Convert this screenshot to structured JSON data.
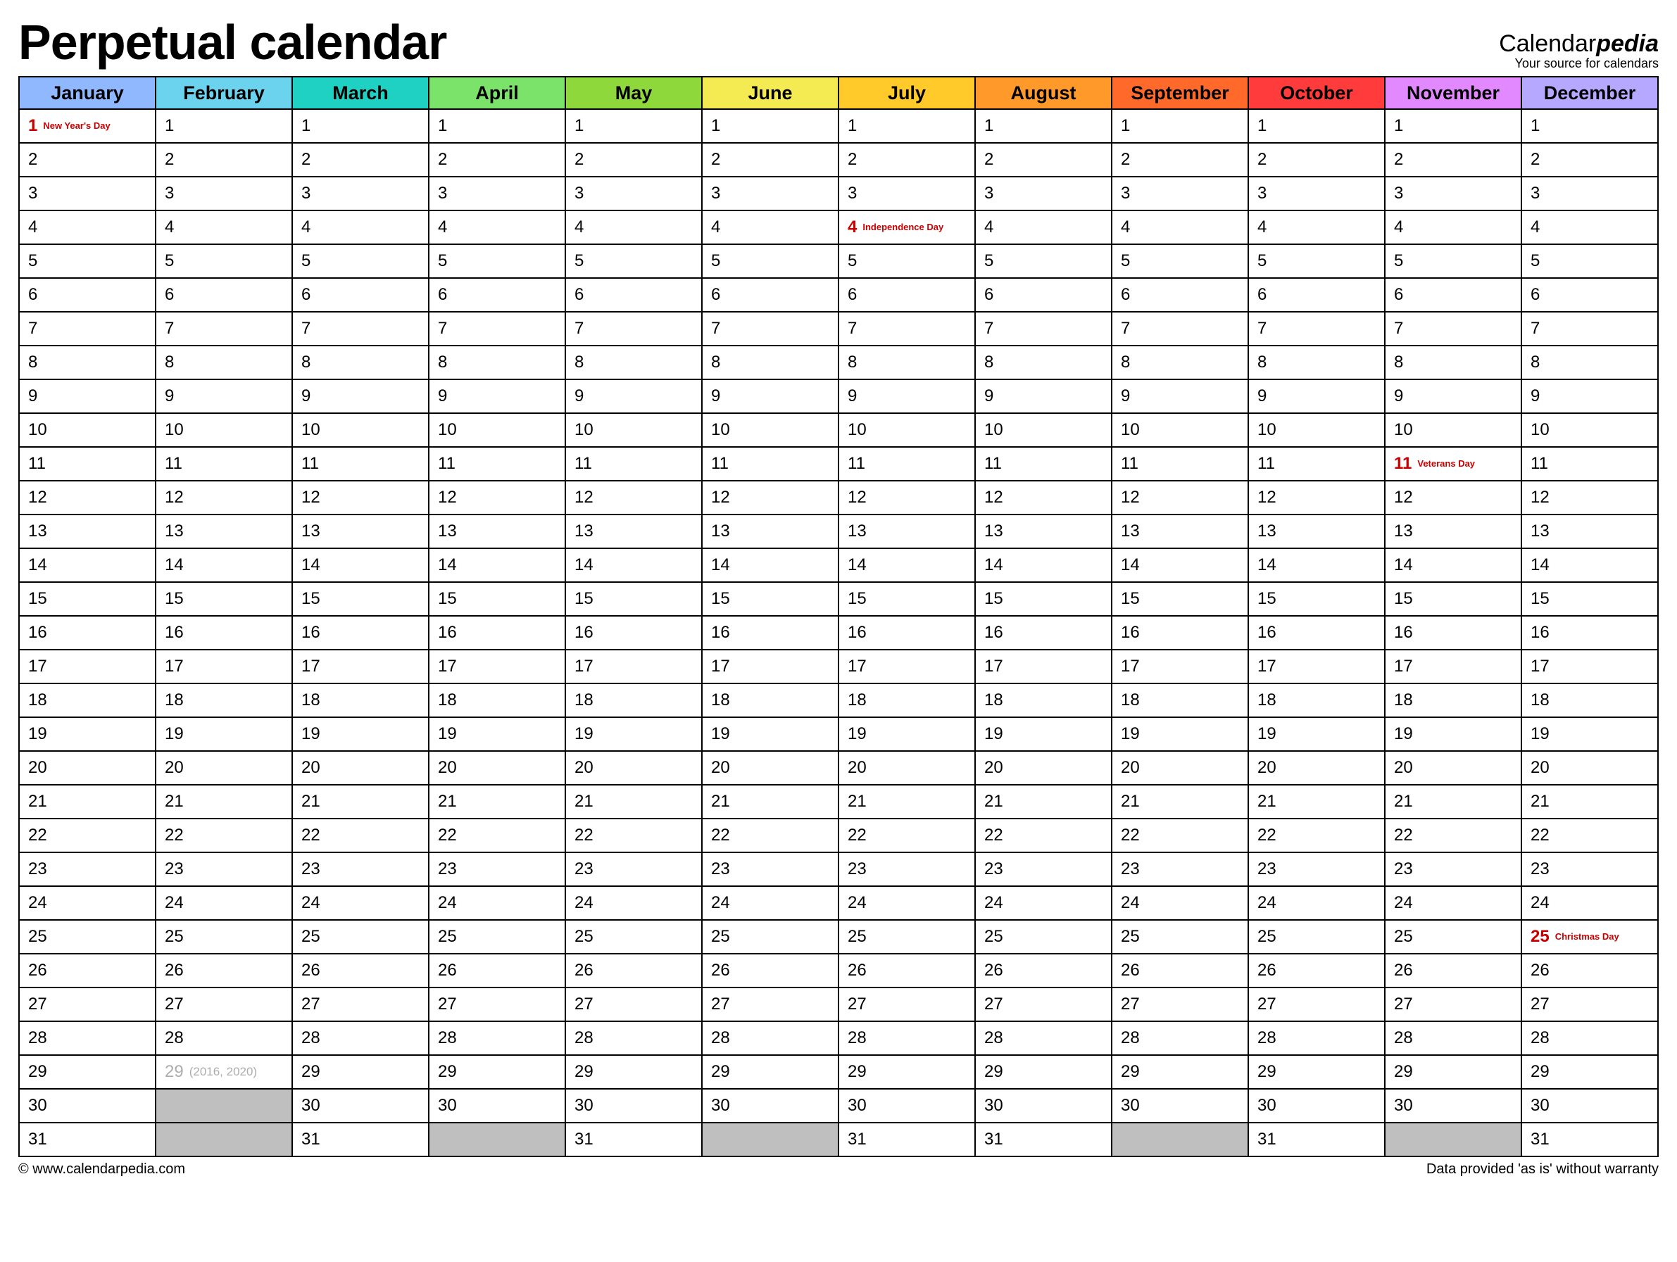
{
  "title": "Perpetual calendar",
  "brand": {
    "name1": "Calendar",
    "name2": "pedia",
    "tagline": "Your source for calendars"
  },
  "footer": {
    "left": "© www.calendarpedia.com",
    "right": "Data provided 'as is' without warranty"
  },
  "months": [
    {
      "name": "January",
      "color": "#8fb8ff",
      "days": 31
    },
    {
      "name": "February",
      "color": "#6bd3ed",
      "days": 29
    },
    {
      "name": "March",
      "color": "#1fd1c2",
      "days": 31
    },
    {
      "name": "April",
      "color": "#7be26a",
      "days": 30
    },
    {
      "name": "May",
      "color": "#8fd83b",
      "days": 31
    },
    {
      "name": "June",
      "color": "#f4eb52",
      "days": 30
    },
    {
      "name": "July",
      "color": "#ffca2a",
      "days": 31
    },
    {
      "name": "August",
      "color": "#ff9a2a",
      "days": 31
    },
    {
      "name": "September",
      "color": "#ff6a2a",
      "days": 30
    },
    {
      "name": "October",
      "color": "#ff3b3b",
      "days": 31
    },
    {
      "name": "November",
      "color": "#e389ff",
      "days": 30
    },
    {
      "name": "December",
      "color": "#b6a7ff",
      "days": 31
    }
  ],
  "holidays": [
    {
      "month": 0,
      "day": 1,
      "label": "New Year's Day"
    },
    {
      "month": 6,
      "day": 4,
      "label": "Independence Day"
    },
    {
      "month": 10,
      "day": 11,
      "label": "Veterans Day"
    },
    {
      "month": 11,
      "day": 25,
      "label": "Christmas Day"
    }
  ],
  "leap": {
    "month": 1,
    "day": 29,
    "note": "(2016, 2020)"
  },
  "max_rows": 31
}
